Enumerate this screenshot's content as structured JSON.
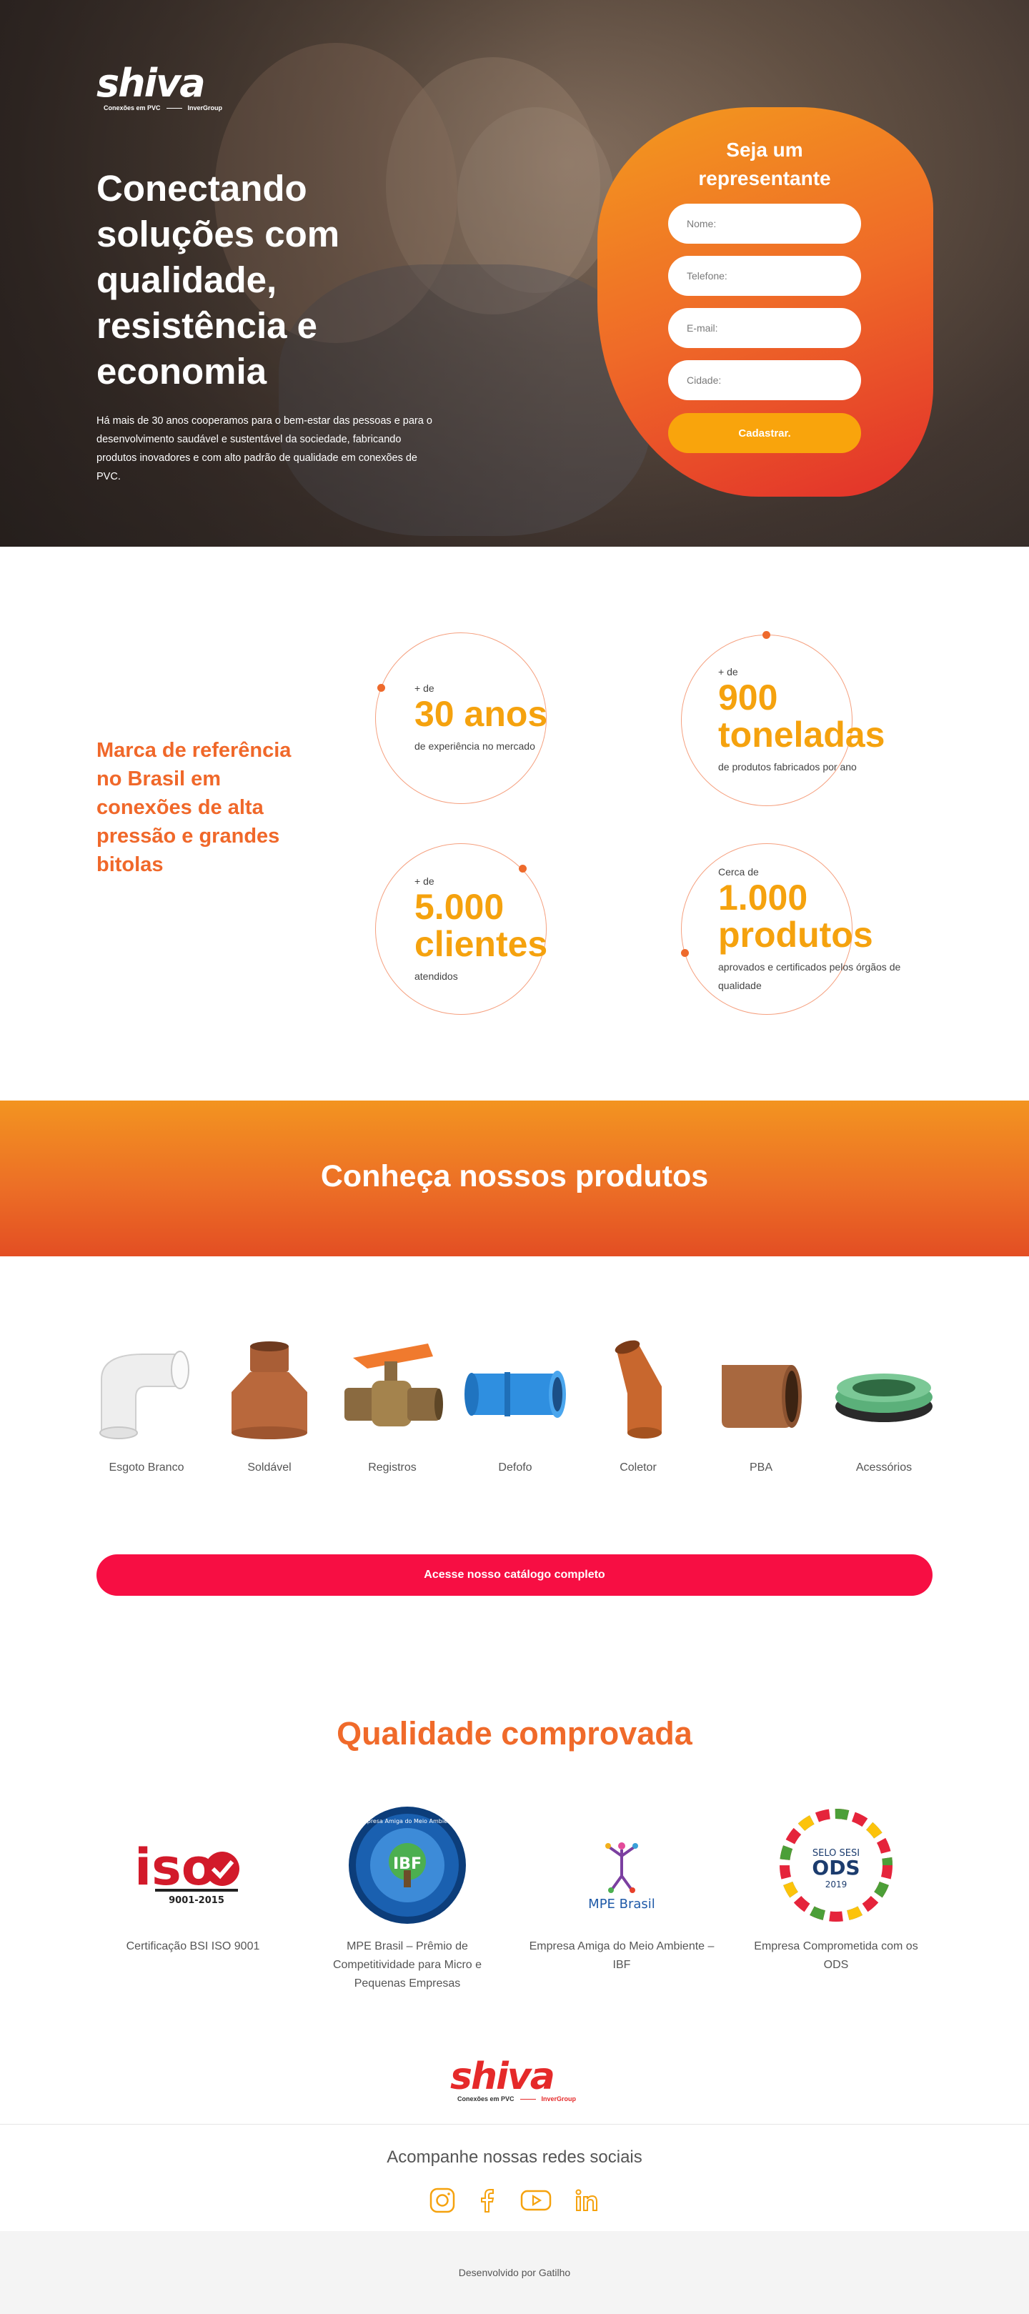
{
  "brand": {
    "name": "shiva",
    "tagline": "Conexões em PVC",
    "group": "InverGroup"
  },
  "hero": {
    "headline": "Conectando soluções com qualidade, resistência e economia",
    "lead": "Há mais de 30 anos cooperamos para o bem-estar das pessoas e para o desenvolvimento saudável e sustentável da sociedade, fabricando produtos inovadores e com alto padrão de qualidade em conexões de PVC."
  },
  "form": {
    "title": "Seja um representante",
    "name_placeholder": "Nome:",
    "phone_placeholder": "Telefone:",
    "email_placeholder": "E-mail:",
    "city_placeholder": "Cidade:",
    "submit_label": "Cadastrar."
  },
  "stats": {
    "brand_statement": "Marca de referência no Brasil em conexões de alta pressão e grandes bitolas",
    "items": [
      {
        "pre": "+ de",
        "value": "30 anos",
        "desc": "de experiência no mercado"
      },
      {
        "pre": "+ de",
        "value": "900 toneladas",
        "desc": "de produtos fabricados por ano"
      },
      {
        "pre": "+ de",
        "value": "5.000 clientes",
        "desc": "atendidos"
      },
      {
        "pre": "Cerca de",
        "value": "1.000 produtos",
        "desc": "aprovados e certificados pelos órgãos de qualidade"
      }
    ]
  },
  "products": {
    "title": "Conheça nossos produtos",
    "items": [
      {
        "label": "Esgoto Branco",
        "icon": "white-elbow-fitting"
      },
      {
        "label": "Soldável",
        "icon": "brown-reducer-fitting"
      },
      {
        "label": "Registros",
        "icon": "valve-with-orange-handle"
      },
      {
        "label": "Defofo",
        "icon": "blue-coupling"
      },
      {
        "label": "Coletor",
        "icon": "orange-elbow-fitting"
      },
      {
        "label": "PBA",
        "icon": "brown-cap"
      },
      {
        "label": "Acessórios",
        "icon": "green-ring"
      }
    ],
    "cta_label": "Acesse nosso catálogo completo"
  },
  "quality": {
    "title": "Qualidade comprovada",
    "items": [
      {
        "label": "Certificação BSI ISO 9001",
        "badge_text": "iso",
        "badge_sub": "9001-2015"
      },
      {
        "label": "MPE Brasil – Prêmio de Competitividade para Micro e Pequenas Empresas",
        "badge_text": "IBF",
        "badge_sub": "Empresa Amiga do Meio Ambiente"
      },
      {
        "label": "Empresa Amiga do Meio Ambiente – IBF",
        "badge_text": "MPE Brasil"
      },
      {
        "label": "Empresa Comprometida com os ODS",
        "badge_text": "ODS",
        "badge_sub": "SELO SESI",
        "badge_year": "2019"
      }
    ]
  },
  "footer": {
    "social_title": "Acompanhe nossas redes sociais",
    "social": [
      "instagram-icon",
      "facebook-icon",
      "youtube-icon",
      "linkedin-icon"
    ],
    "credit": "Desenvolvido por Gatilho"
  },
  "colors": {
    "orange": "#f0682a",
    "yellow": "#f5a20e",
    "red_cta": "#f70e43",
    "brand_red": "#e52a2a"
  }
}
